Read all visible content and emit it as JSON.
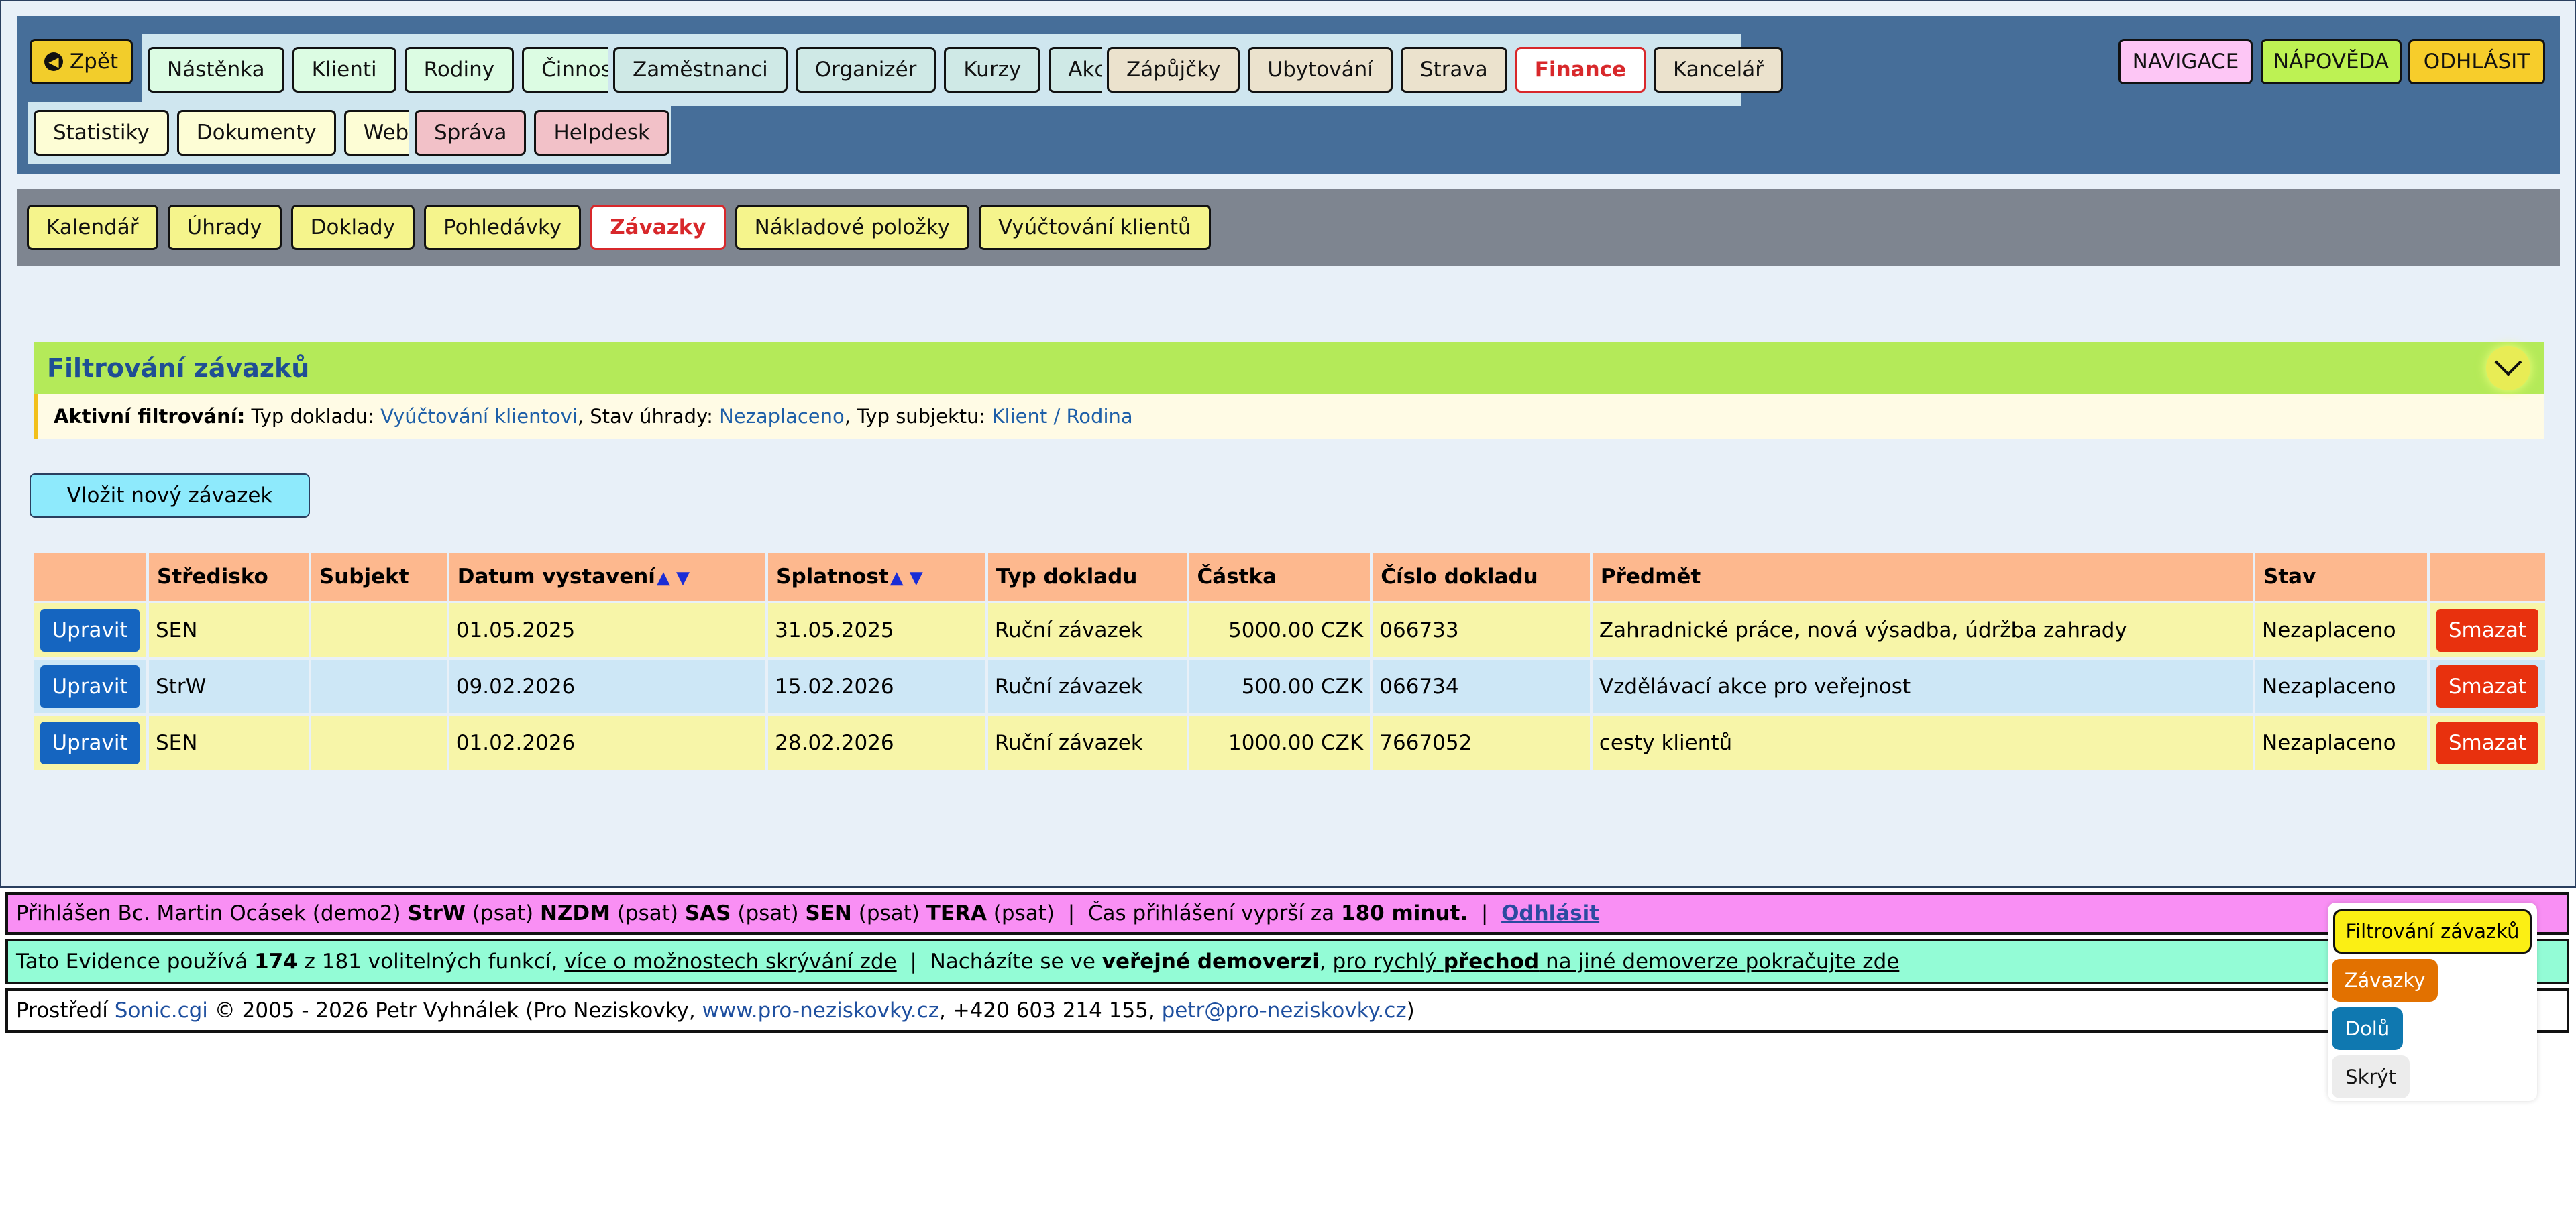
{
  "nav": {
    "back": "Zpět",
    "group1": [
      "Nástěnka",
      "Klienti",
      "Rodiny",
      "Činnosti"
    ],
    "group2": [
      "Zaměstnanci",
      "Organizér",
      "Kurzy",
      "Akce"
    ],
    "group3": [
      "Zápůjčky",
      "Ubytování",
      "Strava",
      "Finance",
      "Kancelář"
    ],
    "group4": [
      "Statistiky",
      "Dokumenty",
      "Web"
    ],
    "group5": [
      "Správa",
      "Helpdesk"
    ],
    "right": {
      "navigace": "NAVIGACE",
      "napoveda": "NÁPOVĚDA",
      "odhlasit": "ODHLÁSIT"
    }
  },
  "subnav": [
    "Kalendář",
    "Úhrady",
    "Doklady",
    "Pohledávky",
    "Závazky",
    "Nákladové položky",
    "Vyúčtování klientů"
  ],
  "filter": {
    "title": "Filtrování závazků",
    "active_label": "Aktivní filtrování:",
    "typ_label": "Typ dokladu:",
    "typ_value": "Vyúčtování klientovi",
    "stav_label": "Stav úhrady:",
    "stav_value": "Nezaplaceno",
    "subjekt_label": "Typ subjektu:",
    "subjekt_value": "Klient / Rodina"
  },
  "new_button": "Vložit nový závazek",
  "table": {
    "headers": [
      "",
      "Středisko",
      "Subjekt",
      "Datum vystavení",
      "Splatnost",
      "Typ dokladu",
      "Částka",
      "Číslo dokladu",
      "Předmět",
      "Stav",
      ""
    ],
    "edit_label": "Upravit",
    "delete_label": "Smazat",
    "rows": [
      {
        "stredisko": "SEN",
        "subjekt": "",
        "datum": "01.05.2025",
        "splatnost": "31.05.2025",
        "typ": "Ruční závazek",
        "castka": "5000.00 CZK",
        "cislo": "066733",
        "predmet": "Zahradnické práce, nová výsadba, údržba zahrady",
        "stav": "Nezaplaceno"
      },
      {
        "stredisko": "StrW",
        "subjekt": "",
        "datum": "09.02.2026",
        "splatnost": "15.02.2026",
        "typ": "Ruční závazek",
        "castka": "500.00 CZK",
        "cislo": "066734",
        "predmet": "Vzdělávací akce pro veřejnost",
        "stav": "Nezaplaceno"
      },
      {
        "stredisko": "SEN",
        "subjekt": "",
        "datum": "01.02.2026",
        "splatnost": "28.02.2026",
        "typ": "Ruční závazek",
        "castka": "1000.00 CZK",
        "cislo": "7667052",
        "predmet": "cesty klientů",
        "stav": "Nezaplaceno"
      }
    ]
  },
  "footer": {
    "login": {
      "prefix": "Přihlášen Bc. Martin Ocásek (demo2)",
      "centers": [
        {
          "name": "StrW",
          "perm": "(psat)"
        },
        {
          "name": "NZDM",
          "perm": "(psat)"
        },
        {
          "name": "SAS",
          "perm": "(psat)"
        },
        {
          "name": "SEN",
          "perm": "(psat)"
        },
        {
          "name": "TERA",
          "perm": "(psat)"
        }
      ],
      "sep": "|",
      "expire_text": "Čas přihlášení vyprší za",
      "expire_value": "180 minut.",
      "logout": "Odhlásit"
    },
    "evidence": {
      "t1": "Tato Evidence používá",
      "used": "174",
      "t2": "z 181 volitelných funkcí,",
      "link1": "více o možnostech skrývání zde",
      "sep": "|",
      "t3": "Nacházíte se ve",
      "demo": "veřejné demoverzi",
      "comma": ",",
      "link2a": "pro rychlý",
      "link2b": "přechod",
      "link2c": "na jiné demoverze pokračujte zde"
    },
    "copyright": {
      "t1": "Prostředí",
      "engine": "Sonic.cgi",
      "t2": "© 2005 - 2026 Petr Vyhnálek (Pro Neziskovky,",
      "web": "www.pro-neziskovky.cz",
      "t3": ", +420 603 214 155,",
      "email": "petr@pro-neziskovky.cz",
      "t4": ")"
    }
  },
  "float_menu": {
    "filter": "Filtrování závazků",
    "zavazky": "Závazky",
    "dolu": "Dolů",
    "skryt": "Skrýt"
  }
}
